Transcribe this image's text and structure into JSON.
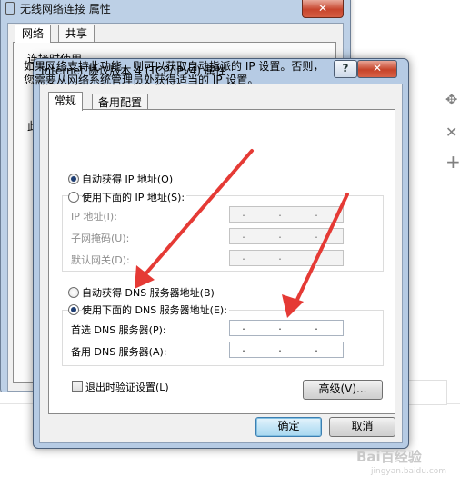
{
  "background_window": {
    "title": "无线网络连接 属性",
    "tabs": [
      "网络",
      "共享"
    ],
    "label_partial_1": "连接时使用",
    "label_partial_2": "此",
    "close_glyph": "✕"
  },
  "right_toolbar": {
    "move_glyph": "✥",
    "close_glyph": "✕",
    "add_glyph": "+"
  },
  "dialog": {
    "title": "Internet 协议版本 4 (TCP/IPv4) 属性",
    "help_glyph": "?",
    "close_glyph": "✕",
    "tabs": [
      {
        "label": "常规",
        "active": true
      },
      {
        "label": "备用配置",
        "active": false
      }
    ],
    "description_line1": "如果网络支持此功能，则可以获取自动指派的 IP 设置。否则，",
    "description_line2": "您需要从网络系统管理员处获得适当的 IP 设置。",
    "ip_auto_label": "自动获得 IP 地址(O)",
    "ip_auto_selected": true,
    "ip_manual_label": "使用下面的 IP 地址(S):",
    "ip_fields": [
      {
        "label": "IP 地址(I):",
        "value": ". . ."
      },
      {
        "label": "子网掩码(U):",
        "value": ". . ."
      },
      {
        "label": "默认网关(D):",
        "value": ". . ."
      }
    ],
    "dns_auto_label": "自动获得 DNS 服务器地址(B)",
    "dns_manual_label": "使用下面的 DNS 服务器地址(E):",
    "dns_manual_selected": true,
    "dns_fields": [
      {
        "label": "首选 DNS 服务器(P):",
        "value": ". . ."
      },
      {
        "label": "备用 DNS 服务器(A):",
        "value": ". . ."
      }
    ],
    "validate_label": "退出时验证设置(L)",
    "validate_checked": false,
    "advanced_button": "高级(V)...",
    "ok_button": "确定",
    "cancel_button": "取消"
  },
  "watermark": {
    "text": "Bai百经验",
    "sub": "jingyan.baidu.com"
  },
  "colors": {
    "annotation_arrow": "#e53a35",
    "title_bar": "#b6cbe4",
    "close_button": "#c64329"
  }
}
